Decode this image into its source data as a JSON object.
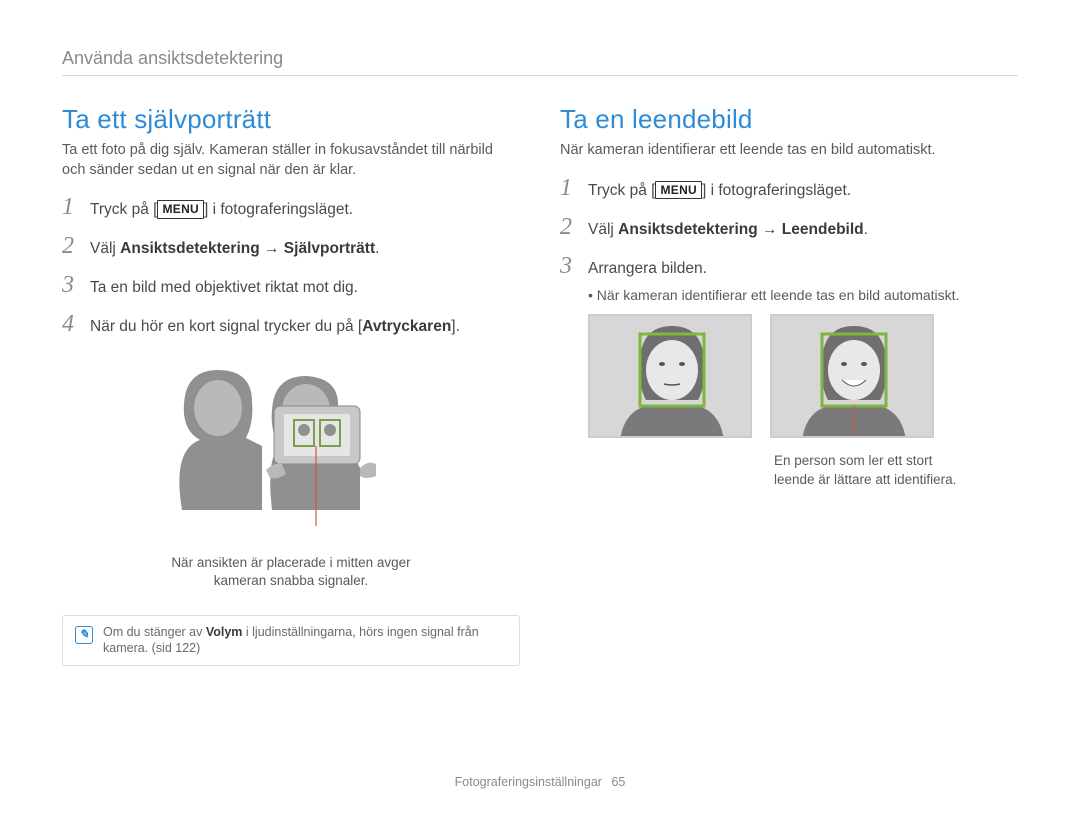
{
  "breadcrumb": "Använda ansiktsdetektering",
  "footer": {
    "section": "Fotograferingsinställningar",
    "page": "65"
  },
  "menu_button_label": "MENU",
  "left": {
    "heading": "Ta ett självporträtt",
    "intro": "Ta ett foto på dig själv. Kameran ställer in fokusavståndet till närbild och sänder sedan ut en signal när den är klar.",
    "steps": {
      "s1_pre": "Tryck på [",
      "s1_post": "] i fotograferingsläget.",
      "s2_pre": "Välj ",
      "s2_bold": "Ansiktsdetektering → Självporträtt",
      "s2_post": ".",
      "s3": "Ta en bild med objektivet riktat mot dig.",
      "s4_pre": "När du hör en kort signal trycker du på [",
      "s4_bold": "Avtryckaren",
      "s4_post": "]."
    },
    "callout": "När ansikten är placerade i mitten avger kameran snabba signaler.",
    "tip_pre": "Om du stänger av ",
    "tip_bold": "Volym",
    "tip_post": " i ljudinställningarna, hörs ingen signal från kamera. (sid 122)"
  },
  "right": {
    "heading": "Ta en leendebild",
    "intro": "När kameran identifierar ett leende tas en bild automatiskt.",
    "steps": {
      "s1_pre": "Tryck på [",
      "s1_post": "] i fotograferingsläget.",
      "s2_pre": "Välj ",
      "s2_bold": "Ansiktsdetektering → Leendebild",
      "s2_post": ".",
      "s3": "Arrangera bilden.",
      "s3_bullet": "När kameran identifierar ett leende tas en bild automatiskt."
    },
    "caption": "En person som ler ett stort leende är lättare att identifiera."
  },
  "nums": [
    "1",
    "2",
    "3",
    "4"
  ]
}
